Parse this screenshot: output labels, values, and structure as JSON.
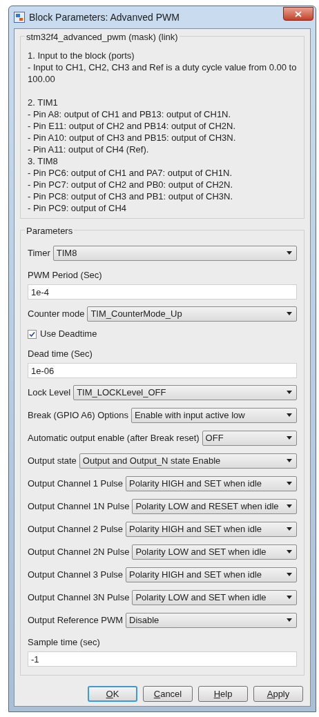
{
  "window": {
    "title": "Block Parameters: Advanved PWM"
  },
  "mask_group": {
    "title": "stm32f4_advanced_pwm (mask) (link)",
    "paragraphs": [
      [
        "1. Input to the block (ports)",
        "- Input to CH1, CH2, CH3 and Ref is a duty cycle value from 0.00 to 100.00"
      ],
      [
        "2. TIM1",
        "- Pin A8: output of CH1 and PB13: output of CH1N.",
        "- Pin E11: output of CH2 and PB14: output of CH2N.",
        "- Pin A10: output of CH3 and PB15: output of CH3N.",
        "- Pin A11: output of CH4 (Ref).",
        "3. TIM8",
        "- Pin PC6: output of CH1 and PA7: output of CH1N.",
        "- Pin PC7: output of CH2 and PB0: output of CH2N.",
        "- Pin PC8: output of CH3 and PB1: output of CH3N.",
        "- Pin PC9: output of CH4"
      ]
    ]
  },
  "parameters": {
    "title": "Parameters",
    "items": [
      {
        "kind": "select",
        "label": "Timer",
        "value": "TIM8"
      },
      {
        "kind": "text",
        "label": "PWM Period (Sec)",
        "value": "1e-4"
      },
      {
        "kind": "select",
        "label": "Counter mode",
        "value": "TIM_CounterMode_Up"
      },
      {
        "kind": "checkbox",
        "label": "Use Deadtime",
        "checked": true
      },
      {
        "kind": "text",
        "label": "Dead time (Sec)",
        "value": "1e-06"
      },
      {
        "kind": "select",
        "label": "Lock Level",
        "value": "TIM_LOCKLevel_OFF"
      },
      {
        "kind": "select",
        "label": "Break (GPIO A6) Options",
        "value": "Enable with input active low"
      },
      {
        "kind": "select",
        "label": "Automatic output enable (after Break reset)",
        "value": "OFF"
      },
      {
        "kind": "select",
        "label": "Output state",
        "value": "Output and Output_N state Enable"
      },
      {
        "kind": "select",
        "label": "Output Channel 1 Pulse",
        "value": "Polarity HIGH and SET when idle"
      },
      {
        "kind": "select",
        "label": "Output Channel 1N Pulse",
        "value": "Polarity LOW and RESET when idle"
      },
      {
        "kind": "select",
        "label": "Output Channel 2 Pulse",
        "value": "Polarity HIGH and SET when idle"
      },
      {
        "kind": "select",
        "label": "Output Channel 2N Pulse",
        "value": "Polarity LOW and SET when idle"
      },
      {
        "kind": "select",
        "label": "Output Channel 3 Pulse",
        "value": "Polarity HIGH and SET when idle"
      },
      {
        "kind": "select",
        "label": "Output Channel 3N Pulse",
        "value": "Polarity LOW and SET when idle"
      },
      {
        "kind": "select",
        "label": "Output Reference PWM",
        "value": "Disable"
      },
      {
        "kind": "text",
        "label": "Sample time (sec)",
        "value": "-1"
      }
    ]
  },
  "buttons": [
    {
      "label": "OK",
      "default": true
    },
    {
      "label": "Cancel",
      "default": false
    },
    {
      "label": "Help",
      "default": false
    },
    {
      "label": "Apply",
      "default": false
    }
  ]
}
